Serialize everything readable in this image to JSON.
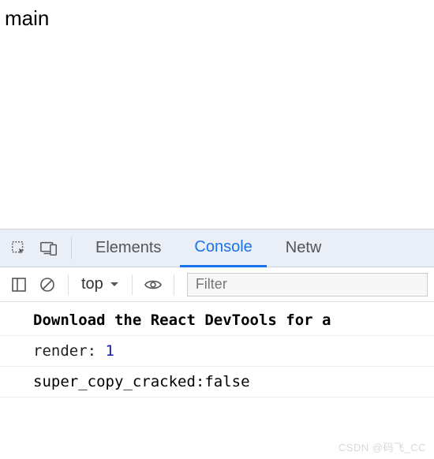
{
  "page": {
    "content": "main"
  },
  "devtools": {
    "tabs": {
      "elements": "Elements",
      "console": "Console",
      "network": "Netw"
    },
    "toolbar": {
      "context": "top",
      "filter_placeholder": "Filter"
    },
    "logs": {
      "row1": "Download the React DevTools for a ",
      "row2_key": "render: ",
      "row2_val": "1",
      "row3": "super_copy_cracked:false"
    }
  },
  "watermark": "CSDN @码飞_CC"
}
